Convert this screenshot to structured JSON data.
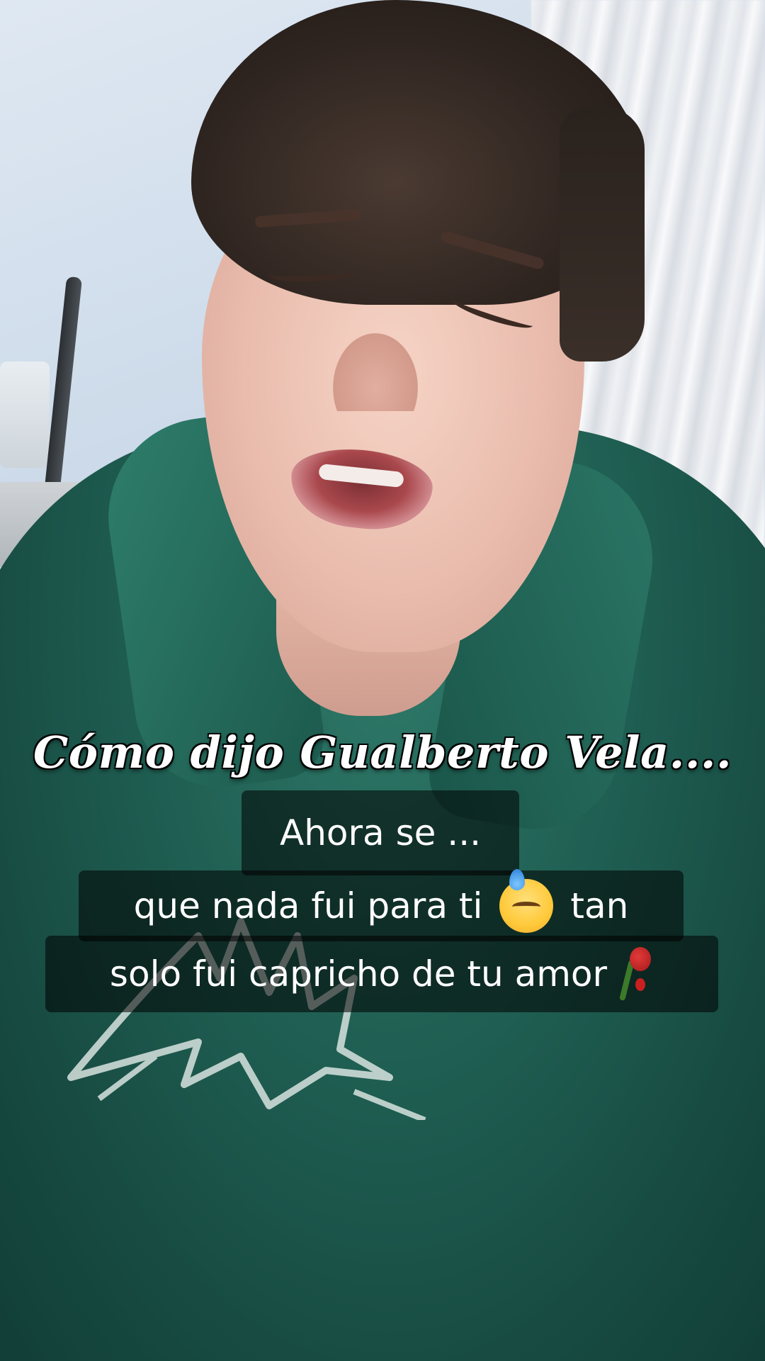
{
  "overlay": {
    "headline": "Cómo dijo Gualberto Vela....",
    "subtitle_line1": "Ahora se ...",
    "subtitle_line2a": "que nada fui para ti",
    "subtitle_line2b": "tan",
    "subtitle_line3": "solo fui capricho de tu amor"
  },
  "icons": {
    "line2_emoji": "downcast-face-with-sweat-icon",
    "line3_emoji": "wilted-rose-icon"
  },
  "colors": {
    "subtitle_bg": "#000000",
    "text": "#ffffff",
    "hoodie": "#1f5e52"
  }
}
